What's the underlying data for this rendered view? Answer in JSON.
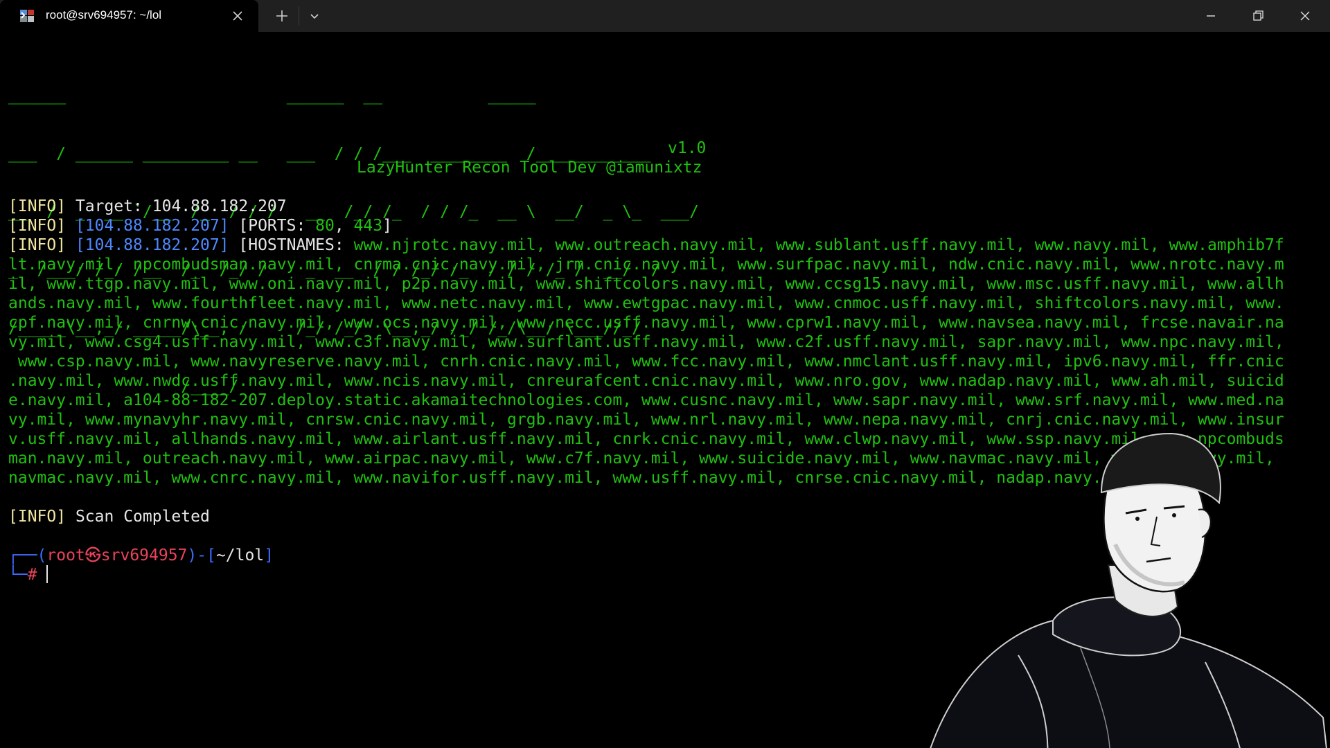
{
  "tab": {
    "title": "root@srv694957: ~/lol",
    "icon": "terminal-icon"
  },
  "icons": {
    "tab_close": "close-icon",
    "new_tab": "plus-icon",
    "dropdown": "chevron-down-icon",
    "minimize": "minimize-icon",
    "maximize": "restore-icon",
    "close": "close-icon"
  },
  "banner": {
    "art": [
      "______                       ______  __           _____",
      "___  / ______ _________ __   ___  / / /___  ________  /____________",
      "__  /  _  __ `/__  /_  / / /   __  /_/ /_  / / /_  __ \\  __/  _ \\_  ___/",
      "_  /___/ /_/ /__  /_  /_/ /    _  __  / / /_/ /_  / / / /_ /  __/  /",
      "/_____\\__,_/ _____/\\__, /     /_/ /_/  \\__,_/ /_/ /_/\\__/ \\___//_/",
      "                  /____/"
    ],
    "version": "v1.0",
    "credit": "LazyHunter Recon Tool Dev @iamunixtz"
  },
  "output": {
    "info_tag": "[INFO]",
    "target_label": "Target:",
    "target_ip": "104.88.182.207",
    "ip_bracket": "[104.88.182.207]",
    "ports_open": "[PORTS:",
    "ports": [
      "80",
      "443"
    ],
    "ports_close": "]",
    "hostnames_label": "[HOSTNAMES:",
    "host_lines": [
      "www.njrotc.navy.mil, www.outreach.navy.mil, www.sublant.usff.navy.mil, www.navy.mil, www.amphib7f",
      "lt.navy.mil, npcombudsman.navy.mil, cnrma.cnic.navy.mil, jrm.cnic.navy.mil, www.surfpac.navy.mil, ndw.cnic.navy.mil, www.nrotc.navy.m",
      "il, www.ttgp.navy.mil, www.oni.navy.mil, p2p.navy.mil, www.shiftcolors.navy.mil, www.ccsg15.navy.mil, www.msc.usff.navy.mil, www.allh",
      "ands.navy.mil, www.fourthfleet.navy.mil, www.netc.navy.mil, www.ewtgpac.navy.mil, www.cnmoc.usff.navy.mil, shiftcolors.navy.mil, www.",
      "cpf.navy.mil, cnrnw.cnic.navy.mil, www.ocs.navy.mil, www.necc.usff.navy.mil, www.cprw1.navy.mil, www.navsea.navy.mil, frcse.navair.na",
      "vy.mil, www.csg4.usff.navy.mil, www.c3f.navy.mil, www.surflant.usff.navy.mil, www.c2f.usff.navy.mil, sapr.navy.mil, www.npc.navy.mil,",
      " www.csp.navy.mil, www.navyreserve.navy.mil, cnrh.cnic.navy.mil, www.fcc.navy.mil, www.nmclant.usff.navy.mil, ipv6.navy.mil, ffr.cnic",
      ".navy.mil, www.nwdc.usff.navy.mil, www.ncis.navy.mil, cnreurafcent.cnic.navy.mil, www.nro.gov, www.nadap.navy.mil, www.ah.mil, suicid",
      "e.navy.mil, a104-88-182-207.deploy.static.akamaitechnologies.com, www.cusnc.navy.mil, www.sapr.navy.mil, www.srf.navy.mil, www.med.na",
      "vy.mil, www.mynavyhr.navy.mil, cnrsw.cnic.navy.mil, grgb.navy.mil, www.nrl.navy.mil, www.nepa.navy.mil, cnrj.cnic.navy.mil, www.insur",
      "v.usff.navy.mil, allhands.navy.mil, www.airlant.usff.navy.mil, cnrk.cnic.navy.mil, www.clwp.navy.mil, www.ssp.navy.mil, www.npcombuds",
      "man.navy.mil, outreach.navy.mil, www.airpac.navy.mil, www.c7f.navy.mil, www.suicide.navy.mil, www.navmac.navy.mil, www.nsw.navy.mil,",
      "navmac.navy.mil, www.cnrc.navy.mil, www.navifor.usff.navy.mil, www.usff.navy.mil, cnrse.cnic.navy.mil, nadap.navy.mil"
    ],
    "host_close": "]",
    "completed": "Scan Completed"
  },
  "prompt": {
    "user": "root",
    "host": "srv694957",
    "path": "~/lol",
    "symbol": "#",
    "at_glyph": "㉿"
  },
  "colors": {
    "green": "#20c010",
    "info_yellow": "#f0e8a0",
    "ip_blue": "#4f88ff",
    "prompt_red": "#e8435a",
    "prompt_blue": "#3b6cff",
    "titlebar": "#202020"
  }
}
